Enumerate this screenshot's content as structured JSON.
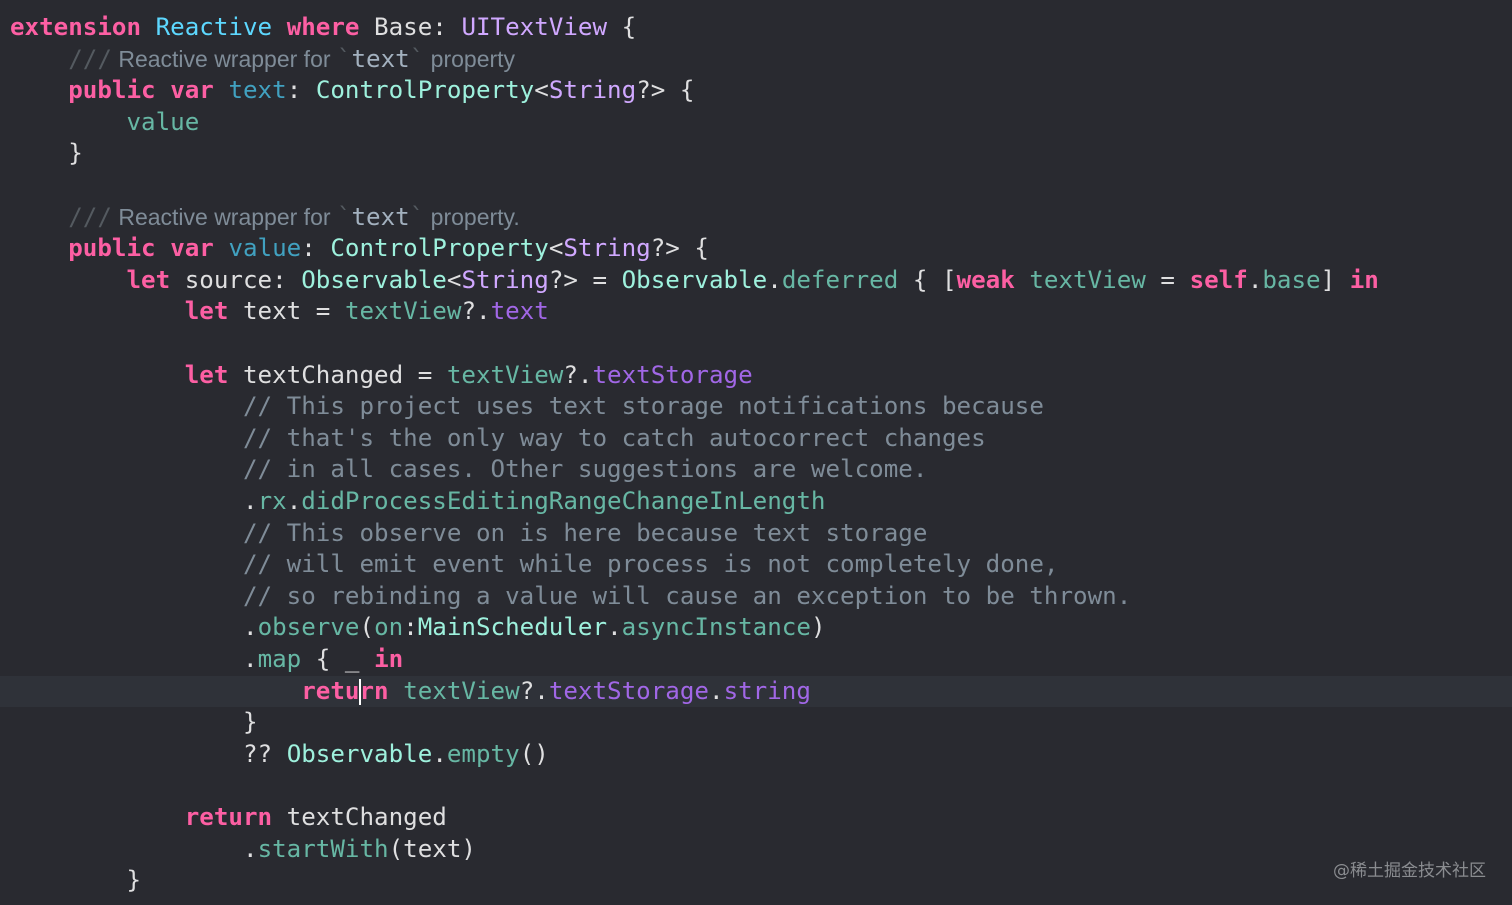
{
  "theme": {
    "background": "#292A30",
    "current_line_background": "#2F3239",
    "keyword": "#FC5FA3",
    "type_declaration": "#5DD8FF",
    "type_system": "#D0A8FF",
    "type_project": "#9EF1DD",
    "identifier_project": "#67B7A4",
    "identifier_system": "#A167E6",
    "plain_text": "#DFDFE0",
    "comment": "#7F8C98"
  },
  "editor": {
    "current_line_index": 21,
    "lines": [
      {
        "tokens": [
          {
            "t": "keyword",
            "v": "extension"
          },
          {
            "t": "plain",
            "v": " "
          },
          {
            "t": "type-decl",
            "v": "Reactive"
          },
          {
            "t": "plain",
            "v": " "
          },
          {
            "t": "keyword",
            "v": "where"
          },
          {
            "t": "plain",
            "v": " Base: "
          },
          {
            "t": "type",
            "v": "UITextView"
          },
          {
            "t": "plain",
            "v": " {"
          }
        ]
      },
      {
        "tokens": [
          {
            "t": "plain",
            "v": "    "
          },
          {
            "t": "doc-mark",
            "v": "///"
          },
          {
            "t": "doc",
            "v": " Reactive wrapper for "
          },
          {
            "t": "doc-mark",
            "v": "`"
          },
          {
            "t": "doc-code",
            "v": "text"
          },
          {
            "t": "doc-mark",
            "v": "`"
          },
          {
            "t": "doc",
            "v": " property"
          }
        ]
      },
      {
        "tokens": [
          {
            "t": "plain",
            "v": "    "
          },
          {
            "t": "keyword",
            "v": "public"
          },
          {
            "t": "plain",
            "v": " "
          },
          {
            "t": "keyword",
            "v": "var"
          },
          {
            "t": "plain",
            "v": " "
          },
          {
            "t": "decl-other",
            "v": "text"
          },
          {
            "t": "plain",
            "v": ": "
          },
          {
            "t": "type-project",
            "v": "ControlProperty"
          },
          {
            "t": "plain",
            "v": "<"
          },
          {
            "t": "type",
            "v": "String"
          },
          {
            "t": "plain",
            "v": "?> {"
          }
        ]
      },
      {
        "tokens": [
          {
            "t": "plain",
            "v": "        "
          },
          {
            "t": "ident-project",
            "v": "value"
          }
        ]
      },
      {
        "tokens": [
          {
            "t": "plain",
            "v": "    }"
          }
        ]
      },
      {
        "tokens": []
      },
      {
        "tokens": [
          {
            "t": "plain",
            "v": "    "
          },
          {
            "t": "doc-mark",
            "v": "///"
          },
          {
            "t": "doc",
            "v": " Reactive wrapper for "
          },
          {
            "t": "doc-mark",
            "v": "`"
          },
          {
            "t": "doc-code",
            "v": "text"
          },
          {
            "t": "doc-mark",
            "v": "`"
          },
          {
            "t": "doc",
            "v": " property."
          }
        ]
      },
      {
        "tokens": [
          {
            "t": "plain",
            "v": "    "
          },
          {
            "t": "keyword",
            "v": "public"
          },
          {
            "t": "plain",
            "v": " "
          },
          {
            "t": "keyword",
            "v": "var"
          },
          {
            "t": "plain",
            "v": " "
          },
          {
            "t": "decl-other",
            "v": "value"
          },
          {
            "t": "plain",
            "v": ": "
          },
          {
            "t": "type-project",
            "v": "ControlProperty"
          },
          {
            "t": "plain",
            "v": "<"
          },
          {
            "t": "type",
            "v": "String"
          },
          {
            "t": "plain",
            "v": "?> {"
          }
        ]
      },
      {
        "tokens": [
          {
            "t": "plain",
            "v": "        "
          },
          {
            "t": "keyword",
            "v": "let"
          },
          {
            "t": "plain",
            "v": " source: "
          },
          {
            "t": "type-project",
            "v": "Observable"
          },
          {
            "t": "plain",
            "v": "<"
          },
          {
            "t": "type",
            "v": "String"
          },
          {
            "t": "plain",
            "v": "?> = "
          },
          {
            "t": "type-project",
            "v": "Observable"
          },
          {
            "t": "plain",
            "v": "."
          },
          {
            "t": "ident-project",
            "v": "deferred"
          },
          {
            "t": "plain",
            "v": " { ["
          },
          {
            "t": "keyword",
            "v": "weak"
          },
          {
            "t": "plain",
            "v": " "
          },
          {
            "t": "ident-project",
            "v": "textView"
          },
          {
            "t": "plain",
            "v": " = "
          },
          {
            "t": "keyword",
            "v": "self"
          },
          {
            "t": "plain",
            "v": "."
          },
          {
            "t": "ident-project",
            "v": "base"
          },
          {
            "t": "plain",
            "v": "] "
          },
          {
            "t": "keyword",
            "v": "in"
          }
        ]
      },
      {
        "tokens": [
          {
            "t": "plain",
            "v": "            "
          },
          {
            "t": "keyword",
            "v": "let"
          },
          {
            "t": "plain",
            "v": " text = "
          },
          {
            "t": "ident-project",
            "v": "textView"
          },
          {
            "t": "plain",
            "v": "?."
          },
          {
            "t": "ident-sys",
            "v": "text"
          }
        ]
      },
      {
        "tokens": []
      },
      {
        "tokens": [
          {
            "t": "plain",
            "v": "            "
          },
          {
            "t": "keyword",
            "v": "let"
          },
          {
            "t": "plain",
            "v": " textChanged = "
          },
          {
            "t": "ident-project",
            "v": "textView"
          },
          {
            "t": "plain",
            "v": "?."
          },
          {
            "t": "ident-sys",
            "v": "textStorage"
          }
        ]
      },
      {
        "tokens": [
          {
            "t": "plain",
            "v": "                "
          },
          {
            "t": "comment",
            "v": "// This project uses text storage notifications because"
          }
        ]
      },
      {
        "tokens": [
          {
            "t": "plain",
            "v": "                "
          },
          {
            "t": "comment",
            "v": "// that's the only way to catch autocorrect changes"
          }
        ]
      },
      {
        "tokens": [
          {
            "t": "plain",
            "v": "                "
          },
          {
            "t": "comment",
            "v": "// in all cases. Other suggestions are welcome."
          }
        ]
      },
      {
        "tokens": [
          {
            "t": "plain",
            "v": "                ."
          },
          {
            "t": "ident-project",
            "v": "rx"
          },
          {
            "t": "plain",
            "v": "."
          },
          {
            "t": "ident-project",
            "v": "didProcessEditingRangeChangeInLength"
          }
        ]
      },
      {
        "tokens": [
          {
            "t": "plain",
            "v": "                "
          },
          {
            "t": "comment",
            "v": "// This observe on is here because text storage"
          }
        ]
      },
      {
        "tokens": [
          {
            "t": "plain",
            "v": "                "
          },
          {
            "t": "comment",
            "v": "// will emit event while process is not completely done,"
          }
        ]
      },
      {
        "tokens": [
          {
            "t": "plain",
            "v": "                "
          },
          {
            "t": "comment",
            "v": "// so rebinding a value will cause an exception to be thrown."
          }
        ]
      },
      {
        "tokens": [
          {
            "t": "plain",
            "v": "                ."
          },
          {
            "t": "ident-project",
            "v": "observe"
          },
          {
            "t": "plain",
            "v": "("
          },
          {
            "t": "ident-project",
            "v": "on"
          },
          {
            "t": "plain",
            "v": ":"
          },
          {
            "t": "type-project",
            "v": "MainScheduler"
          },
          {
            "t": "plain",
            "v": "."
          },
          {
            "t": "ident-project",
            "v": "asyncInstance"
          },
          {
            "t": "plain",
            "v": ")"
          }
        ]
      },
      {
        "tokens": [
          {
            "t": "plain",
            "v": "                ."
          },
          {
            "t": "ident-project",
            "v": "map"
          },
          {
            "t": "plain",
            "v": " { _ "
          },
          {
            "t": "keyword",
            "v": "in"
          }
        ]
      },
      {
        "tokens": [
          {
            "t": "plain",
            "v": "                    "
          },
          {
            "t": "keyword",
            "v": "retu"
          },
          {
            "t": "cursor",
            "v": ""
          },
          {
            "t": "keyword",
            "v": "rn"
          },
          {
            "t": "plain",
            "v": " "
          },
          {
            "t": "ident-project",
            "v": "textView"
          },
          {
            "t": "plain",
            "v": "?."
          },
          {
            "t": "ident-sys",
            "v": "textStorage"
          },
          {
            "t": "plain",
            "v": "."
          },
          {
            "t": "ident-sys",
            "v": "string"
          }
        ]
      },
      {
        "tokens": [
          {
            "t": "plain",
            "v": "                }"
          }
        ]
      },
      {
        "tokens": [
          {
            "t": "plain",
            "v": "                ?? "
          },
          {
            "t": "type-project",
            "v": "Observable"
          },
          {
            "t": "plain",
            "v": "."
          },
          {
            "t": "ident-project",
            "v": "empty"
          },
          {
            "t": "plain",
            "v": "()"
          }
        ]
      },
      {
        "tokens": []
      },
      {
        "tokens": [
          {
            "t": "plain",
            "v": "            "
          },
          {
            "t": "keyword",
            "v": "return"
          },
          {
            "t": "plain",
            "v": " textChanged"
          }
        ]
      },
      {
        "tokens": [
          {
            "t": "plain",
            "v": "                ."
          },
          {
            "t": "ident-project",
            "v": "startWith"
          },
          {
            "t": "plain",
            "v": "(text)"
          }
        ]
      },
      {
        "tokens": [
          {
            "t": "plain",
            "v": "        }"
          }
        ]
      }
    ]
  },
  "watermark": {
    "text": "@稀土掘金技术社区"
  }
}
